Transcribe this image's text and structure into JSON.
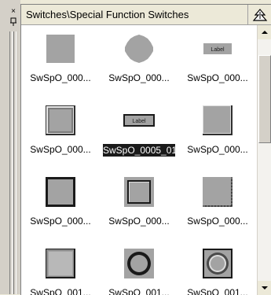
{
  "window": {
    "title": "Switches\\Special Function Switches",
    "close_glyph": "×"
  },
  "selected_index": 4,
  "items": [
    {
      "caption": "SwSpO_000...",
      "icon": "plain-square-switch"
    },
    {
      "caption": "SwSpO_000...",
      "icon": "round-jagged-switch"
    },
    {
      "caption": "SwSpO_000...",
      "icon": "label-switch",
      "thumb_text": "Label"
    },
    {
      "caption": "SwSpO_000...",
      "icon": "raised-square-switch"
    },
    {
      "caption": "SwSpO_0005_01",
      "icon": "label-switch-framed",
      "thumb_text": "Label"
    },
    {
      "caption": "SwSpO_000...",
      "icon": "shaded-square-switch"
    },
    {
      "caption": "SwSpO_000...",
      "icon": "black-frame-switch"
    },
    {
      "caption": "SwSpO_000...",
      "icon": "double-frame-switch"
    },
    {
      "caption": "SwSpO_000...",
      "icon": "notched-square-switch"
    },
    {
      "caption": "SwSpO_001...",
      "icon": "bevel-square-switch"
    },
    {
      "caption": "SwSpO_001...",
      "icon": "ring-round-switch"
    },
    {
      "caption": "SwSpO_001...",
      "icon": "bevel-round-switch"
    }
  ],
  "colors": {
    "switch_fill": "#a3a3a3",
    "selection": "#1a1a1a"
  }
}
